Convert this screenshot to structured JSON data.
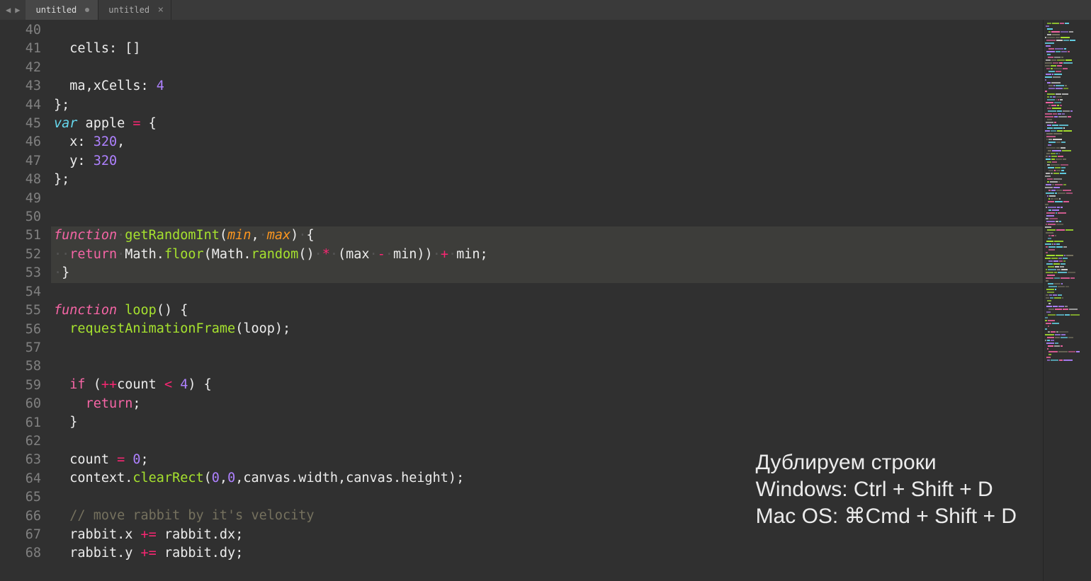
{
  "tabs": [
    {
      "label": "untitled",
      "modified": true,
      "active": true
    },
    {
      "label": "untitled",
      "modified": false,
      "active": false
    }
  ],
  "startLine": 40,
  "endLine": 68,
  "overlay": {
    "line1": "Дублируем строки",
    "line2": "Windows: Ctrl + Shift + D",
    "line3": "Mac OS: ⌘Cmd + Shift + D"
  },
  "code": {
    "40": [],
    "41": [
      [
        "tx",
        "  cells: []"
      ]
    ],
    "42": [],
    "43": [
      [
        "tx",
        "  ma,xCells: "
      ],
      [
        "nm",
        "4"
      ]
    ],
    "44": [
      [
        "tx",
        "};"
      ]
    ],
    "45": [
      [
        "st",
        "var"
      ],
      [
        "tx",
        " apple "
      ],
      [
        "op",
        "="
      ],
      [
        "tx",
        " {"
      ]
    ],
    "46": [
      [
        "tx",
        "  x: "
      ],
      [
        "nm",
        "320"
      ],
      [
        "tx",
        ","
      ]
    ],
    "47": [
      [
        "tx",
        "  y: "
      ],
      [
        "nm",
        "320"
      ]
    ],
    "48": [
      [
        "tx",
        "};"
      ]
    ],
    "49": [],
    "50": [],
    "51": [
      [
        "kw",
        "function"
      ],
      [
        "ws",
        "·"
      ],
      [
        "fn",
        "getRandomInt"
      ],
      [
        "tx",
        "("
      ],
      [
        "pm",
        "min"
      ],
      [
        "tx",
        ","
      ],
      [
        "ws",
        "·"
      ],
      [
        "pm",
        "max"
      ],
      [
        "tx",
        ")"
      ],
      [
        "ws",
        "·"
      ],
      [
        "tx",
        "{"
      ]
    ],
    "52": [
      [
        "ws",
        "··"
      ],
      [
        "kw2",
        "return"
      ],
      [
        "ws",
        "·"
      ],
      [
        "tx",
        "Math."
      ],
      [
        "fn",
        "floor"
      ],
      [
        "tx",
        "(Math."
      ],
      [
        "fn",
        "random"
      ],
      [
        "tx",
        "()"
      ],
      [
        "ws",
        "·"
      ],
      [
        "op",
        "*"
      ],
      [
        "ws",
        "·"
      ],
      [
        "tx",
        "(max"
      ],
      [
        "ws",
        "·"
      ],
      [
        "op",
        "-"
      ],
      [
        "ws",
        "·"
      ],
      [
        "tx",
        "min))"
      ],
      [
        "ws",
        "·"
      ],
      [
        "op",
        "+"
      ],
      [
        "ws",
        "·"
      ],
      [
        "tx",
        "min;"
      ]
    ],
    "53": [
      [
        "ws",
        "·"
      ],
      [
        "tx",
        "}"
      ]
    ],
    "54": [],
    "55": [
      [
        "kw",
        "function"
      ],
      [
        "tx",
        " "
      ],
      [
        "fn",
        "loop"
      ],
      [
        "tx",
        "() {"
      ]
    ],
    "56": [
      [
        "tx",
        "  "
      ],
      [
        "fn",
        "requestAnimationFrame"
      ],
      [
        "tx",
        "(loop);"
      ]
    ],
    "57": [],
    "58": [],
    "59": [
      [
        "tx",
        "  "
      ],
      [
        "kw2",
        "if"
      ],
      [
        "tx",
        " ("
      ],
      [
        "op",
        "++"
      ],
      [
        "tx",
        "count "
      ],
      [
        "op",
        "<"
      ],
      [
        "tx",
        " "
      ],
      [
        "nm",
        "4"
      ],
      [
        "tx",
        ") {"
      ]
    ],
    "60": [
      [
        "tx",
        "    "
      ],
      [
        "kw2",
        "return"
      ],
      [
        "tx",
        ";"
      ]
    ],
    "61": [
      [
        "tx",
        "  }"
      ]
    ],
    "62": [],
    "63": [
      [
        "tx",
        "  count "
      ],
      [
        "op",
        "="
      ],
      [
        "tx",
        " "
      ],
      [
        "nm",
        "0"
      ],
      [
        "tx",
        ";"
      ]
    ],
    "64": [
      [
        "tx",
        "  context."
      ],
      [
        "fn",
        "clearRect"
      ],
      [
        "tx",
        "("
      ],
      [
        "nm",
        "0"
      ],
      [
        "tx",
        ","
      ],
      [
        "nm",
        "0"
      ],
      [
        "tx",
        ",canvas.width,canvas.height);"
      ]
    ],
    "65": [],
    "66": [
      [
        "tx",
        "  "
      ],
      [
        "cm",
        "// move rabbit by it's velocity"
      ]
    ],
    "67": [
      [
        "tx",
        "  rabbit.x "
      ],
      [
        "op",
        "+="
      ],
      [
        "tx",
        " rabbit.dx;"
      ]
    ],
    "68": [
      [
        "tx",
        "  rabbit.y "
      ],
      [
        "op",
        "+="
      ],
      [
        "tx",
        " rabbit.dy;"
      ]
    ]
  }
}
